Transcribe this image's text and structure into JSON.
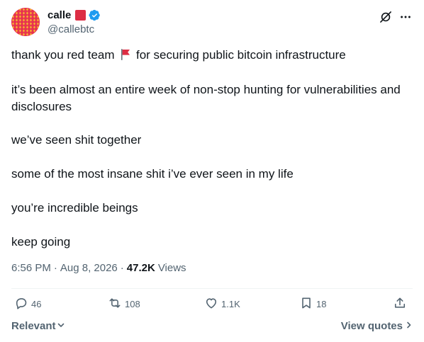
{
  "author": {
    "display_name": "calle",
    "handle": "@callebtc",
    "avatar_icon": "pattern-avatar-icon",
    "verified_icon": "verified-badge-icon",
    "emoji_icon": "red-square-icon"
  },
  "tweet": {
    "paragraphs": [
      {
        "before_flag": "thank you red team",
        "after_flag": "for securing public bitcoin infrastructure"
      },
      {
        "text": "it’s been almost an entire week of non-stop hunting for vulnerabilities and disclosures"
      },
      {
        "text": "we’ve seen shit together"
      },
      {
        "text": "some of the most insane shit i’ve ever seen in my life"
      },
      {
        "text": "you’re incredible beings"
      },
      {
        "text": "keep going"
      }
    ]
  },
  "meta": {
    "time": "6:56 PM",
    "separator": "·",
    "date": "Aug 8, 2026",
    "views_count": "47.2K",
    "views_label": "Views"
  },
  "actions": {
    "replies": "46",
    "reposts": "108",
    "likes": "1.1K",
    "bookmarks": "18"
  },
  "footer": {
    "sort_label": "Relevant",
    "view_quotes_label": "View quotes"
  },
  "colors": {
    "text": "#0f1419",
    "muted": "#536471",
    "verified": "#1d9bf0",
    "flag": "#dd2e44"
  }
}
